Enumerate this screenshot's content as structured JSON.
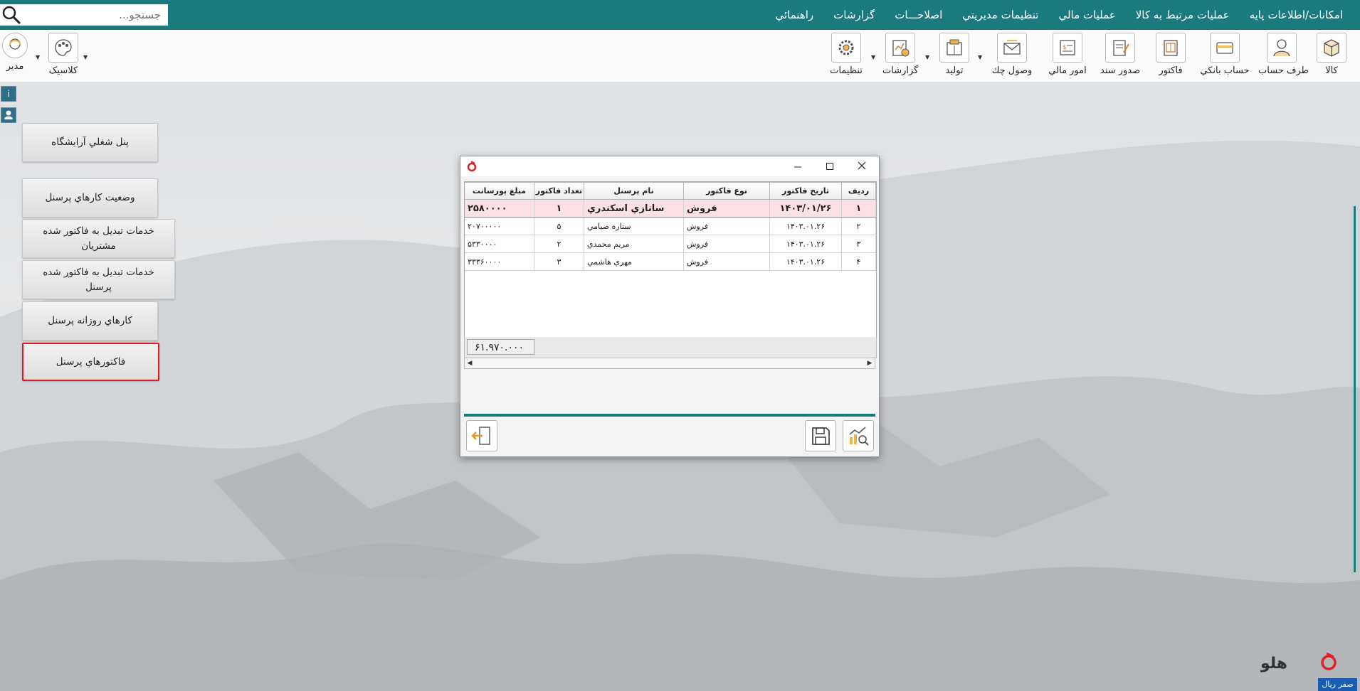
{
  "menubar": {
    "search_placeholder": "جستجو...",
    "items": [
      "امکانات/اطلاعات پايه",
      "عمليات مرتبط به کالا",
      "عمليات مالي",
      "تنظيمات مديريتي",
      "اصلاحـــات",
      "گزارشات",
      "راهنمائي"
    ]
  },
  "toolbar": {
    "items": [
      {
        "label": "کالا",
        "icon": "box-icon"
      },
      {
        "label": "طرف حساب",
        "icon": "person-icon"
      },
      {
        "label": "حساب بانکي",
        "icon": "bank-card-icon"
      },
      {
        "label": "فاکتور",
        "icon": "invoice-icon"
      },
      {
        "label": "صدور سند",
        "icon": "document-pen-icon"
      },
      {
        "label": "امور مالي",
        "icon": "money-icon"
      },
      {
        "label": "وصول چك",
        "icon": "cheque-envelope-icon"
      },
      {
        "label": "توليد",
        "icon": "production-icon"
      },
      {
        "label": "گزارشات",
        "icon": "report-chart-icon"
      },
      {
        "label": "تنظيمات",
        "icon": "gear-icon"
      }
    ],
    "left": {
      "theme_label": "کلاسيک",
      "user_label": "مدير"
    }
  },
  "side": {
    "buttons": [
      "پنل شغلي آرايشگاه",
      "وضعيت کارهاي پرسنل",
      "خدمات تبديل به فاکتور شده مشتريان",
      "خدمات تبديل به فاکتور شده پرسنل",
      "کارهاي روزانه پرسنل",
      "فاکتورهاي پرسنل"
    ]
  },
  "dialog": {
    "columns": [
      "رديف",
      "تاريخ فاکتور",
      "نوع فاکتور",
      "نام پرسنل",
      "تعداد فاکتور",
      "مبلغ پورسانت"
    ],
    "rows": [
      {
        "row": "۱",
        "date": "۱۴۰۳/۰۱/۲۶",
        "type": "فروش",
        "name": "سانازي اسکندري",
        "count": "۱",
        "amount": "۲۵۸۰۰۰۰"
      },
      {
        "row": "۲",
        "date": "۱۴۰۳.۰۱.۲۶",
        "type": "فروش",
        "name": "ستاره صيامي",
        "count": "۵",
        "amount": "۲۰۷۰۰۰۰۰"
      },
      {
        "row": "۳",
        "date": "۱۴۰۳.۰۱.۲۶",
        "type": "فروش",
        "name": "مريم محمدي",
        "count": "۲",
        "amount": "۵۳۳۰۰۰۰"
      },
      {
        "row": "۴",
        "date": "۱۴۰۳.۰۱.۲۶",
        "type": "فروش",
        "name": "مهري هاشمي",
        "count": "۳",
        "amount": "۳۳۳۶۰۰۰۰"
      }
    ],
    "total": "۶۱.۹۷۰.۰۰۰"
  },
  "status": {
    "brand": "هلو",
    "zero_rial": "صفر ريال"
  },
  "colors": {
    "teal": "#1a7a7d",
    "selected_row": "#fbe0e6",
    "active_border": "#e21b23"
  }
}
